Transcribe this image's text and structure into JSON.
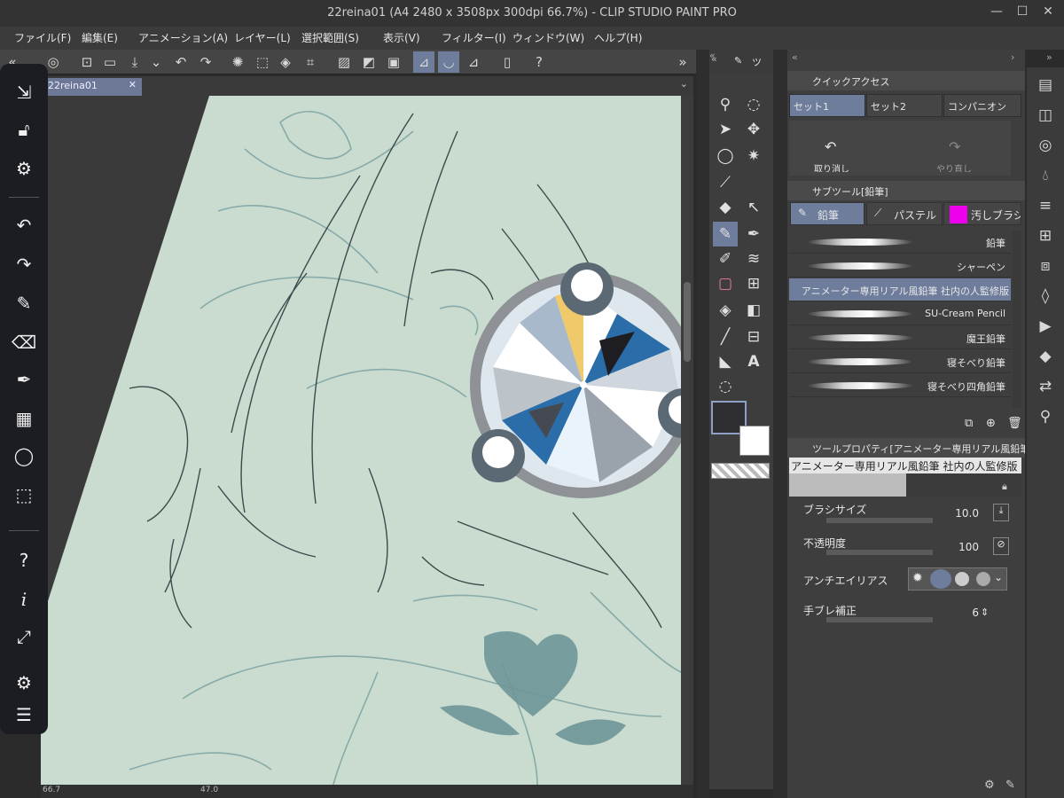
{
  "window": {
    "title": "22reina01 (A4 2480 x 3508px 300dpi 66.7%) - CLIP STUDIO PAINT PRO"
  },
  "menu": [
    "ファイル(F)",
    "編集(E)",
    "アニメーション(A)",
    "レイヤー(L)",
    "選択範囲(S)",
    "表示(V)",
    "フィルター(I)",
    "ウィンドウ(W)",
    "ヘルプ(H)"
  ],
  "document": {
    "tab_label": "22reina01"
  },
  "tool_panel": {
    "header_label": "ツ"
  },
  "quick_access": {
    "title": "クイックアクセス",
    "tabs": [
      "セット1",
      "セット2",
      "コンパニオン"
    ],
    "undo_label": "取り消し",
    "redo_label": "やり直し"
  },
  "subtool": {
    "title": "サブツール[鉛筆]",
    "tabs": [
      "鉛筆",
      "パステル",
      "汚しブラシ"
    ],
    "brushes": [
      "鉛筆",
      "シャーペン",
      "アニメーター専用リアル風鉛筆 社内の人監修版",
      "SU-Cream Pencil",
      "魔王鉛筆",
      "寝そべり鉛筆",
      "寝そべり四角鉛筆"
    ]
  },
  "tool_property": {
    "title": "ツールプロパティ[アニメーター専用リアル風鉛筆",
    "preset_name": "アニメーター専用リアル風鉛筆 社内の人監修版",
    "brush_size_label": "ブラシサイズ",
    "brush_size_value": "10.0",
    "opacity_label": "不透明度",
    "opacity_value": "100",
    "antialias_label": "アンチエイリアス",
    "stabilization_label": "手ブレ補正",
    "stabilization_value": "6"
  },
  "status": {
    "zoom": "66.7",
    "angle": "47.0"
  },
  "colors": {
    "canvas": "#c9dccf",
    "accent": "#6e7d9c",
    "line": "#3c4a4c",
    "main_color": "#2f2f33",
    "sub_color": "#ffffff"
  }
}
